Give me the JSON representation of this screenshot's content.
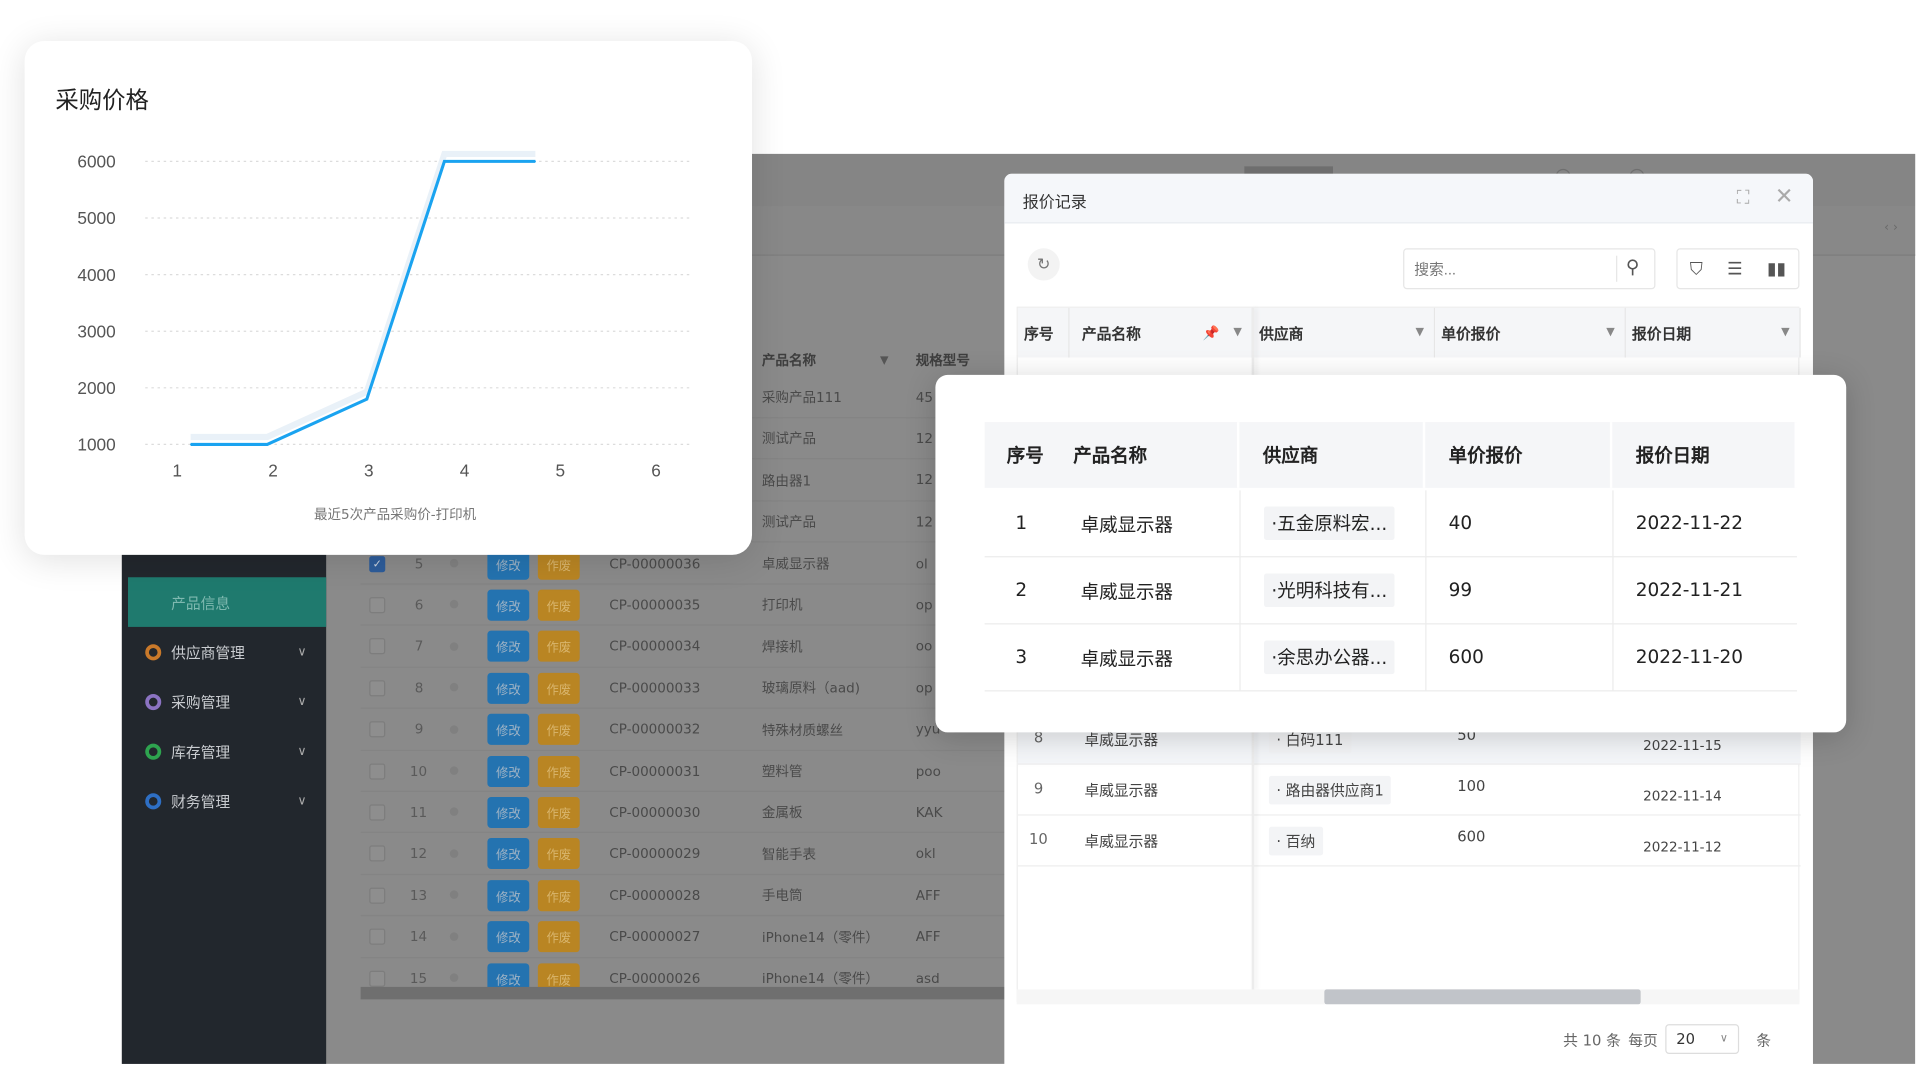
{
  "background_app": {
    "sidebar": {
      "active_item": "产品信息",
      "items": [
        {
          "label": "供应商管理",
          "icon": "ring-icon",
          "color": "#c9792a"
        },
        {
          "label": "采购管理",
          "icon": "ring-icon",
          "color": "#8b73c2"
        },
        {
          "label": "库存管理",
          "icon": "ring-icon",
          "color": "#2ea44f"
        },
        {
          "label": "财务管理",
          "icon": "ring-icon",
          "color": "#2e6fc4"
        }
      ]
    },
    "table": {
      "headers": {
        "product_name": "产品名称",
        "spec": "规格型号"
      },
      "edit_label": "修改",
      "void_label": "作废",
      "top_rows": [
        {
          "name": "采购产品111",
          "spec": "45"
        },
        {
          "name": "测试产品",
          "spec": "12"
        },
        {
          "name": "路由器1",
          "spec": "12"
        },
        {
          "name": "测试产品",
          "spec": "12"
        }
      ],
      "rows": [
        {
          "no": "5",
          "code": "CP-00000036",
          "name": "卓威显示器",
          "spec": "ol",
          "checked": true
        },
        {
          "no": "6",
          "code": "CP-00000035",
          "name": "打印机",
          "spec": "op"
        },
        {
          "no": "7",
          "code": "CP-00000034",
          "name": "焊接机",
          "spec": "oo"
        },
        {
          "no": "8",
          "code": "CP-00000033",
          "name": "玻璃原料（aad)",
          "spec": "op"
        },
        {
          "no": "9",
          "code": "CP-00000032",
          "name": "特殊材质螺丝",
          "spec": "yyu"
        },
        {
          "no": "10",
          "code": "CP-00000031",
          "name": "塑料管",
          "spec": "poo"
        },
        {
          "no": "11",
          "code": "CP-00000030",
          "name": "金属板",
          "spec": "KAK"
        },
        {
          "no": "12",
          "code": "CP-00000029",
          "name": "智能手表",
          "spec": "okl"
        },
        {
          "no": "13",
          "code": "CP-00000028",
          "name": "手电筒",
          "spec": "AFF"
        },
        {
          "no": "14",
          "code": "CP-00000027",
          "name": "iPhone14（零件）",
          "spec": "AFF"
        },
        {
          "no": "15",
          "code": "CP-00000026",
          "name": "iPhone14（零件）",
          "spec": "asd"
        }
      ]
    }
  },
  "modal": {
    "title": "报价记录",
    "search_placeholder": "搜索...",
    "toolbar_icons": [
      "filter-icon",
      "columns-icon",
      "chart-icon"
    ],
    "headers": [
      "序号",
      "产品名称",
      "供应商",
      "单价报价",
      "报价日期"
    ],
    "rows": [
      {
        "no": "8",
        "name": "卓威显示器",
        "supplier": "· 白码111",
        "price": "50",
        "date": "2022-11-15"
      },
      {
        "no": "9",
        "name": "卓威显示器",
        "supplier": "· 路由器供应商1",
        "price": "100",
        "date": "2022-11-14"
      },
      {
        "no": "10",
        "name": "卓威显示器",
        "supplier": "· 百纳",
        "price": "600",
        "date": "2022-11-12"
      }
    ],
    "pager": {
      "total": "共 10 条",
      "per_page": "每页",
      "page_size": "20",
      "unit": "条"
    }
  },
  "popup": {
    "headers": [
      "序号",
      "产品名称",
      "供应商",
      "单价报价",
      "报价日期"
    ],
    "rows": [
      {
        "no": "1",
        "name": "卓威显示器",
        "supplier": "·五金原料宏...",
        "price": "40",
        "date": "2022-11-22"
      },
      {
        "no": "2",
        "name": "卓威显示器",
        "supplier": "·光明科技有...",
        "price": "99",
        "date": "2022-11-21"
      },
      {
        "no": "3",
        "name": "卓威显示器",
        "supplier": "·余思办公器...",
        "price": "600",
        "date": "2022-11-20"
      }
    ]
  },
  "chart_card": {
    "title": "采购价格"
  },
  "chart_data": {
    "type": "line",
    "title": "采购价格",
    "xlabel": "最近5次产品采购价-打印机",
    "x_ticks": [
      1,
      2,
      3,
      4,
      5,
      6
    ],
    "y_ticks": [
      1000,
      2000,
      3000,
      4000,
      5000,
      6000
    ],
    "xlim": [
      1,
      6
    ],
    "ylim": [
      1000,
      6000
    ],
    "grid": true,
    "line_color": "#1aa3f0",
    "points": [
      {
        "x": 1.14,
        "y": 1000
      },
      {
        "x": 1.94,
        "y": 1000
      },
      {
        "x": 2.98,
        "y": 1800
      },
      {
        "x": 3.79,
        "y": 6000
      },
      {
        "x": 4.74,
        "y": 6000
      }
    ]
  }
}
